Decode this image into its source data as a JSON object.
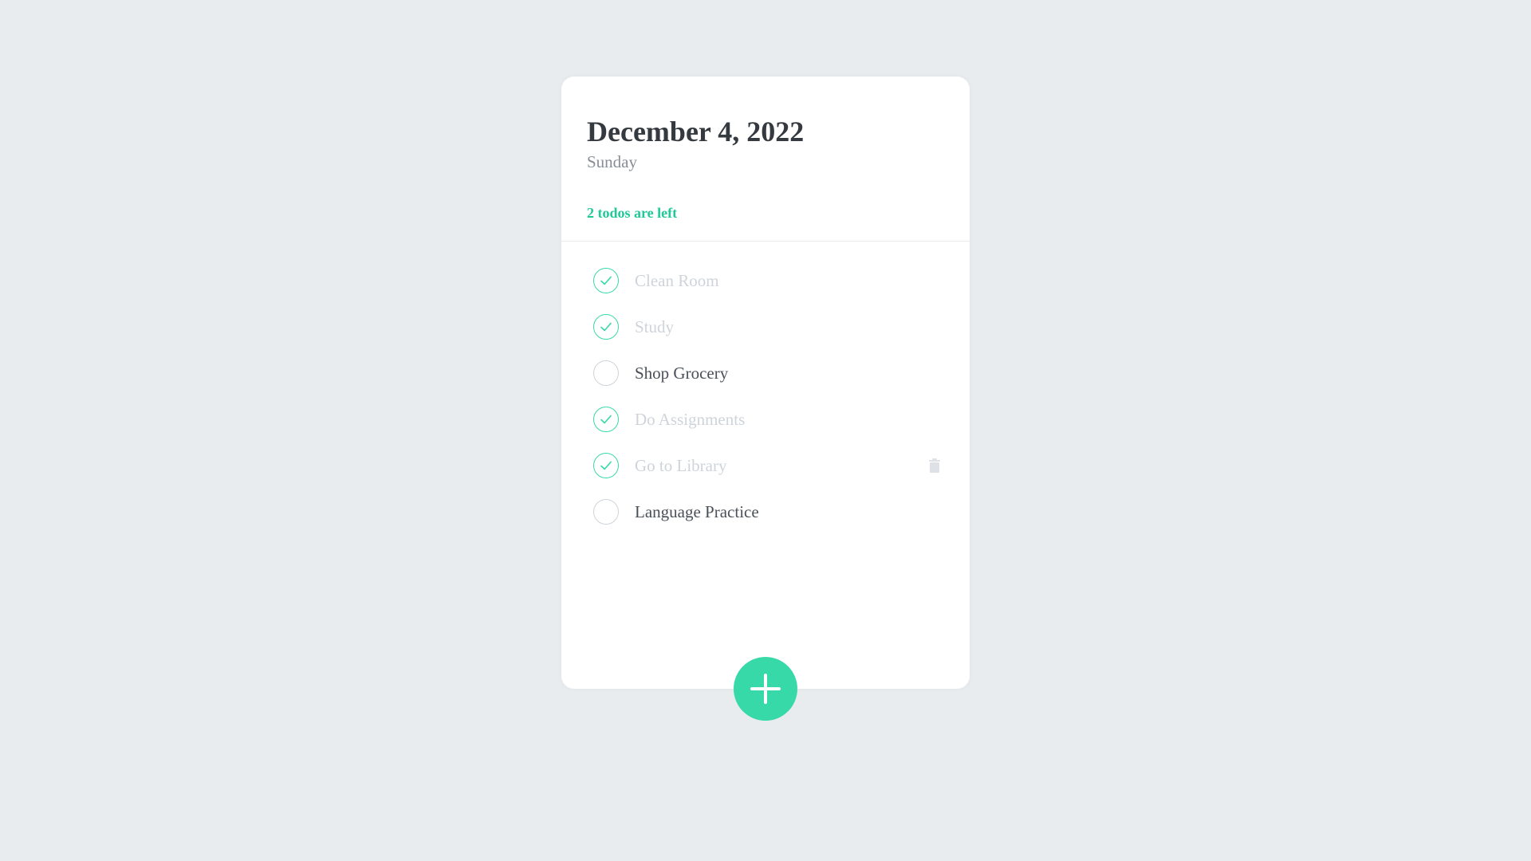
{
  "header": {
    "date": "December 4, 2022",
    "weekday": "Sunday",
    "tasks_left": "2 todos are left"
  },
  "todos": [
    {
      "text": "Clean Room",
      "done": true
    },
    {
      "text": "Study",
      "done": true
    },
    {
      "text": "Shop Grocery",
      "done": false
    },
    {
      "text": "Do Assignments",
      "done": true
    },
    {
      "text": "Go to Library",
      "done": true,
      "remove_visible": true
    },
    {
      "text": "Language Practice",
      "done": false
    }
  ],
  "icons": {
    "check": "check-icon",
    "remove": "trash-icon",
    "add": "plus-icon"
  },
  "colors": {
    "accent": "#38d9a9",
    "accent_text": "#20c997",
    "background": "#e9ecef",
    "done_text": "#ced4da",
    "text": "#495057",
    "title": "#343a40",
    "subtitle": "#868e96",
    "trash": "#dee2e6"
  }
}
